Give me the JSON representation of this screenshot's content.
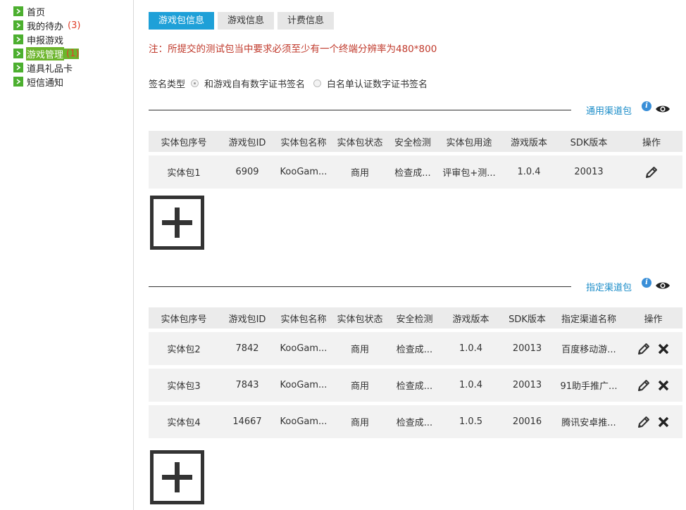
{
  "sidebar": {
    "items": [
      {
        "label": "首页",
        "count": "",
        "active": false
      },
      {
        "label": "我的待办",
        "count": "(3)",
        "active": false
      },
      {
        "label": "申报游戏",
        "count": "",
        "active": false
      },
      {
        "label": "游戏管理",
        "count": "(1)",
        "active": true
      },
      {
        "label": "道具礼品卡",
        "count": "",
        "active": false
      },
      {
        "label": "短信通知",
        "count": "",
        "active": false
      }
    ]
  },
  "tabs": [
    "游戏包信息",
    "游戏信息",
    "计费信息"
  ],
  "notice": "注：所提交的测试包当中要求必须至少有一个终端分辨率为480*800",
  "signature": {
    "label": "签名类型",
    "option1": "和游戏自有数字证书签名",
    "option2": "白名单认证数字证书签名",
    "selected": 0
  },
  "general": {
    "title": "通用渠道包",
    "headers": [
      "实体包序号",
      "游戏包ID",
      "实体包名称",
      "实体包状态",
      "安全检测",
      "实体包用途",
      "游戏版本",
      "SDK版本",
      "操作"
    ],
    "rows": [
      [
        "实体包1",
        "6909",
        "KooGam...",
        "商用",
        "检查成...",
        "评审包+测...",
        "1.0.4",
        "20013"
      ]
    ]
  },
  "specific": {
    "title": "指定渠道包",
    "headers": [
      "实体包序号",
      "游戏包ID",
      "实体包名称",
      "实体包状态",
      "安全检测",
      "游戏版本",
      "SDK版本",
      "指定渠道名称",
      "操作"
    ],
    "rows": [
      [
        "实体包2",
        "7842",
        "KooGam...",
        "商用",
        "检查成...",
        "1.0.4",
        "20013",
        "百度移动游..."
      ],
      [
        "实体包3",
        "7843",
        "KooGam...",
        "商用",
        "检查成...",
        "1.0.4",
        "20013",
        "91助手推广..."
      ],
      [
        "实体包4",
        "14667",
        "KooGam...",
        "商用",
        "检查成...",
        "1.0.5",
        "20016",
        "腾讯安卓推..."
      ]
    ]
  },
  "icons": {
    "nav": "chevron-right-icon",
    "info": "info-icon",
    "view": "eye-icon",
    "edit": "pencil-icon",
    "delete": "close-icon",
    "add": "plus-icon"
  },
  "colors": {
    "tab_active": "#1ea0d8",
    "notice": "#c0392b",
    "link": "#1a8cc8",
    "nav_active": "#6cb52c",
    "count": "#e0402b"
  }
}
